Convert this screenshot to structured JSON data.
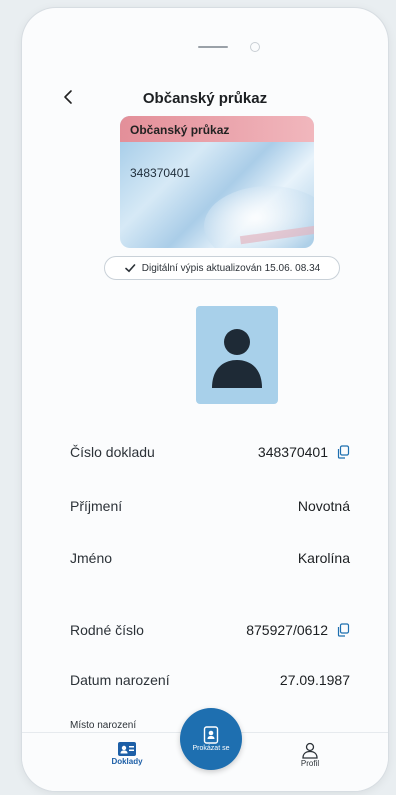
{
  "header": {
    "title": "Občanský průkaz"
  },
  "card": {
    "title": "Občanský průkaz",
    "number": "348370401"
  },
  "status": {
    "text": "Digitální výpis aktualizován 15.06. 08.34"
  },
  "details": [
    {
      "label": "Číslo dokladu",
      "value": "348370401"
    },
    {
      "label": "Příjmení",
      "value": "Novotná"
    },
    {
      "label": "Jméno",
      "value": "Karolína"
    },
    {
      "label": "Rodné číslo",
      "value": "875927/0612"
    },
    {
      "label": "Datum narození",
      "value": "27.09.1987"
    }
  ],
  "partial_label": "Místo narození",
  "tabbar": {
    "documents": "Doklady",
    "prove": "Prokázat se",
    "profile": "Profil"
  },
  "colors": {
    "accent": "#1e6fb0",
    "photo_bg": "#a8d0ea"
  }
}
